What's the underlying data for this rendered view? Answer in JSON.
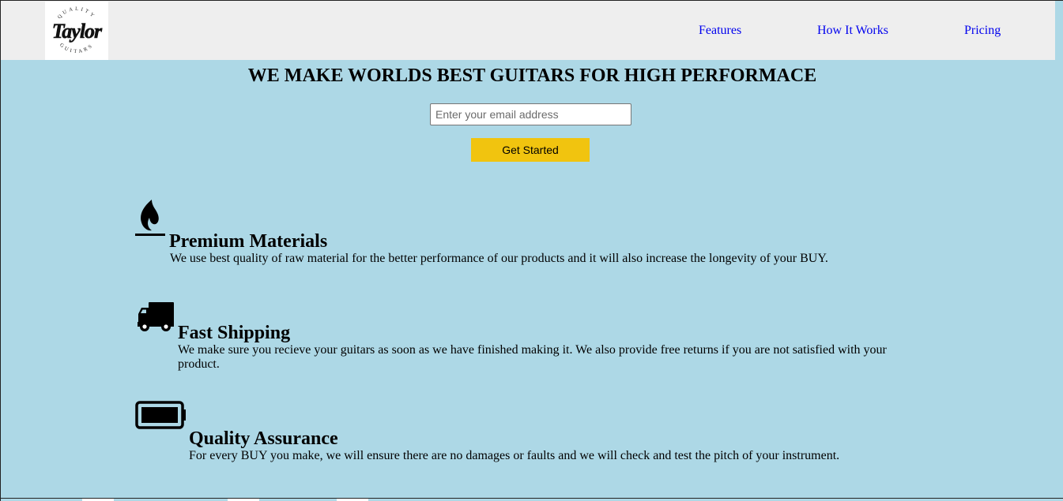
{
  "header": {
    "logo": {
      "wordmark": "Taylor",
      "arc_top": "QUALITY",
      "arc_bottom": "GUITARS"
    },
    "nav": [
      {
        "label": "Features"
      },
      {
        "label": "How It Works"
      },
      {
        "label": "Pricing"
      }
    ]
  },
  "hero": {
    "title": "WE MAKE WORLDS BEST GUITARS FOR HIGH PERFORMACE",
    "email_placeholder": "Enter your email address",
    "email_value": "",
    "cta_label": "Get Started"
  },
  "features": [
    {
      "icon": "fire-icon",
      "title": "Premium Materials",
      "description": "We use best quality of raw material for the better performance of our products and it will also increase the longevity of your BUY."
    },
    {
      "icon": "truck-icon",
      "title": "Fast Shipping",
      "description": "We make sure you recieve your guitars as soon as we have finished making it. We also provide free returns if you are not satisfied with your product."
    },
    {
      "icon": "battery-full-icon",
      "title": "Quality Assurance",
      "description": "For every BUY you make, we will ensure there are no damages or faults and we will check and test the pitch of your instrument."
    }
  ],
  "colors": {
    "page_background": "#add8e6",
    "header_background": "#eeeeee",
    "link": "#0000ee",
    "cta_background": "#f1c40f"
  }
}
